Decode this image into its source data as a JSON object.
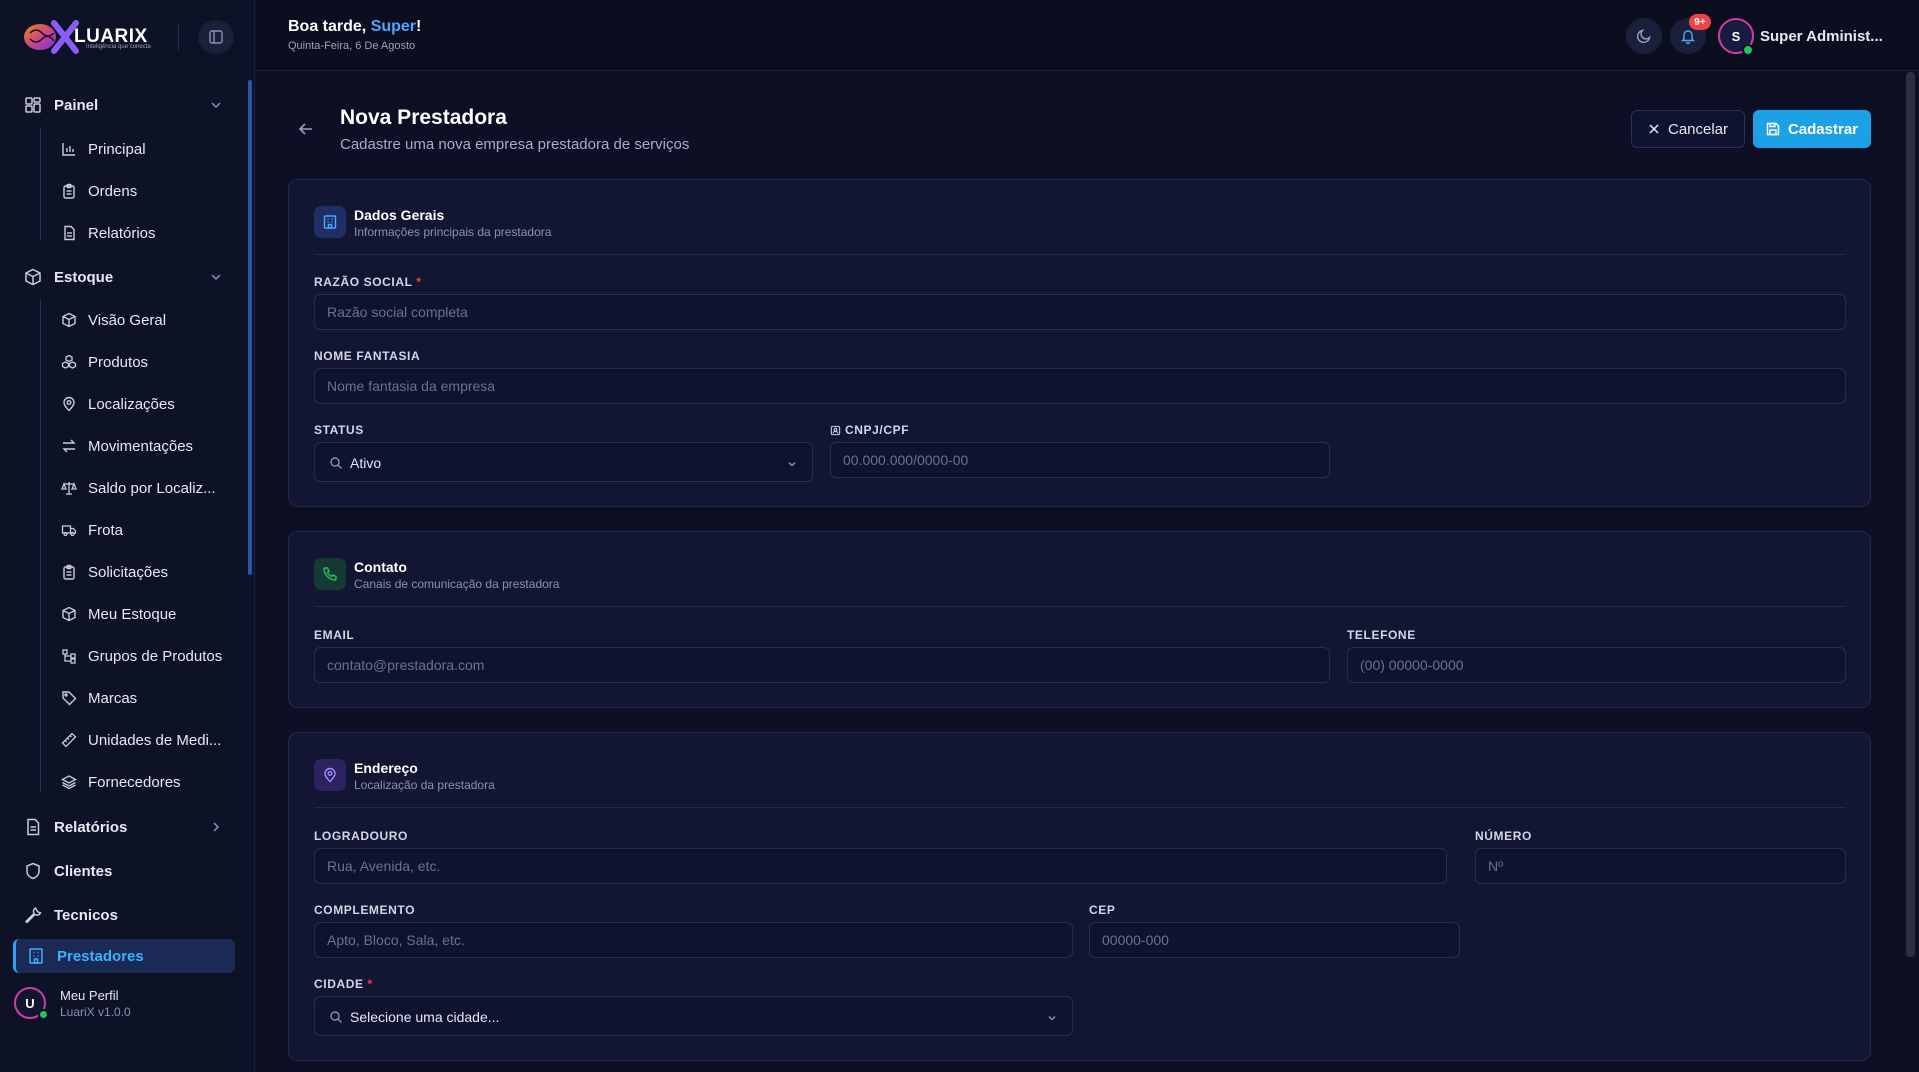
{
  "brand": {
    "name": "LUARIX",
    "tagline": "Inteligência que conecta"
  },
  "header": {
    "greeting_prefix": "Boa tarde, ",
    "greeting_name": "Super",
    "greeting_suffix": "!",
    "date": "Quinta-Feira, 6 De Agosto",
    "notifications_badge": "9+",
    "avatar_initial": "S",
    "user_name": "Super Administ..."
  },
  "sidebar": {
    "groups": [
      {
        "label": "Painel",
        "icon": "dashboard-icon",
        "expanded": true
      },
      {
        "label": "Estoque",
        "icon": "box-icon",
        "expanded": true
      },
      {
        "label": "Relatórios",
        "icon": "report-icon",
        "expanded": false
      },
      {
        "label": "Clientes",
        "icon": "shield-icon"
      },
      {
        "label": "Tecnicos",
        "icon": "wrench-icon"
      },
      {
        "label": "Prestadores",
        "icon": "building-icon",
        "active": true
      }
    ],
    "painel_items": [
      {
        "label": "Principal",
        "icon": "bar-chart-icon"
      },
      {
        "label": "Ordens",
        "icon": "clipboard-icon"
      },
      {
        "label": "Relatórios",
        "icon": "file-text-icon"
      }
    ],
    "estoque_items": [
      {
        "label": "Visão Geral",
        "icon": "box-icon"
      },
      {
        "label": "Produtos",
        "icon": "boxes-icon"
      },
      {
        "label": "Localizações",
        "icon": "map-pin-icon"
      },
      {
        "label": "Movimentações",
        "icon": "arrows-icon"
      },
      {
        "label": "Saldo por Localiz...",
        "icon": "scale-icon"
      },
      {
        "label": "Frota",
        "icon": "truck-icon"
      },
      {
        "label": "Solicitações",
        "icon": "clipboard-icon"
      },
      {
        "label": "Meu Estoque",
        "icon": "box-icon"
      },
      {
        "label": "Grupos de Produtos",
        "icon": "network-icon"
      },
      {
        "label": "Marcas",
        "icon": "tag-icon"
      },
      {
        "label": "Unidades de Medi...",
        "icon": "ruler-icon"
      },
      {
        "label": "Fornecedores",
        "icon": "layers-icon"
      }
    ],
    "profile": {
      "initial": "U",
      "label": "Meu Perfil",
      "version": "LuariX v1.0.0"
    }
  },
  "page": {
    "title": "Nova Prestadora",
    "subtitle": "Cadastre uma nova empresa prestadora de serviços",
    "cancel_label": "Cancelar",
    "save_label": "Cadastrar"
  },
  "dados_gerais": {
    "title": "Dados Gerais",
    "subtitle": "Informações principais da prestadora",
    "razao_social_label": "RAZÃO SOCIAL",
    "razao_social_placeholder": "Razão social completa",
    "razao_social_value": "",
    "nome_fantasia_label": "NOME FANTASIA",
    "nome_fantasia_placeholder": "Nome fantasia da empresa",
    "nome_fantasia_value": "",
    "status_label": "STATUS",
    "status_value": "Ativo",
    "cnpj_label": "CNPJ/CPF",
    "cnpj_placeholder": "00.000.000/0000-00",
    "cnpj_value": ""
  },
  "contato": {
    "title": "Contato",
    "subtitle": "Canais de comunicação da prestadora",
    "email_label": "EMAIL",
    "email_placeholder": "contato@prestadora.com",
    "email_value": "",
    "telefone_label": "TELEFONE",
    "telefone_placeholder": "(00) 00000-0000",
    "telefone_value": ""
  },
  "endereco": {
    "title": "Endereço",
    "subtitle": "Localização da prestadora",
    "logradouro_label": "LOGRADOURO",
    "logradouro_placeholder": "Rua, Avenida, etc.",
    "logradouro_value": "",
    "numero_label": "NÚMERO",
    "numero_placeholder": "Nº",
    "numero_value": "",
    "complemento_label": "COMPLEMENTO",
    "complemento_placeholder": "Apto, Bloco, Sala, etc.",
    "complemento_value": "",
    "cep_label": "CEP",
    "cep_placeholder": "00000-000",
    "cep_value": "",
    "cidade_label": "CIDADE",
    "cidade_value": "Selecione uma cidade..."
  },
  "colors": {
    "accent": "#1da1e6",
    "active_text": "#38b4ff",
    "background": "#0d1024",
    "card": "#121632",
    "required": "#ef4444",
    "online": "#22c55e"
  }
}
